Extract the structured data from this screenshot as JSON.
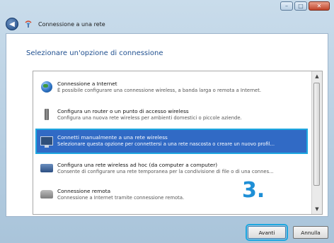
{
  "window": {
    "minimize_glyph": "–",
    "maximize_glyph": "□",
    "close_glyph": "✕"
  },
  "nav": {
    "back_glyph": "◀",
    "title": "Connessione a una rete"
  },
  "heading": "Selezionare un'opzione di connessione",
  "options": [
    {
      "title": "Connessione a Internet",
      "desc": "È possibile configurare una connessione wireless, a banda larga o remota a Internet.",
      "icon": "globe-icon",
      "selected": false
    },
    {
      "title": "Configura un router o un punto di accesso wireless",
      "desc": "Configura una nuova rete wireless per ambienti domestici o piccole aziende.",
      "icon": "router-icon",
      "selected": false
    },
    {
      "title": "Connetti manualmente a una rete wireless",
      "desc": "Selezionare questa opzione per connettersi a una rete nascosta o creare un nuovo profil...",
      "icon": "monitor-icon",
      "selected": true
    },
    {
      "title": "Configura una rete wireless ad hoc (da computer a computer)",
      "desc": "Consente di configurare una rete temporanea per la condivisione di file o di una connes...",
      "icon": "adhoc-network-icon",
      "selected": false
    },
    {
      "title": "Connessione remota",
      "desc": "Connessione a Internet tramite connessione remota.",
      "icon": "phone-icon",
      "selected": false
    }
  ],
  "step_label": "3.",
  "buttons": {
    "next": "Avanti",
    "cancel": "Annulla"
  },
  "colors": {
    "selection": "#316ac5",
    "highlight": "#1ea7e0",
    "heading": "#1f4f8f"
  }
}
